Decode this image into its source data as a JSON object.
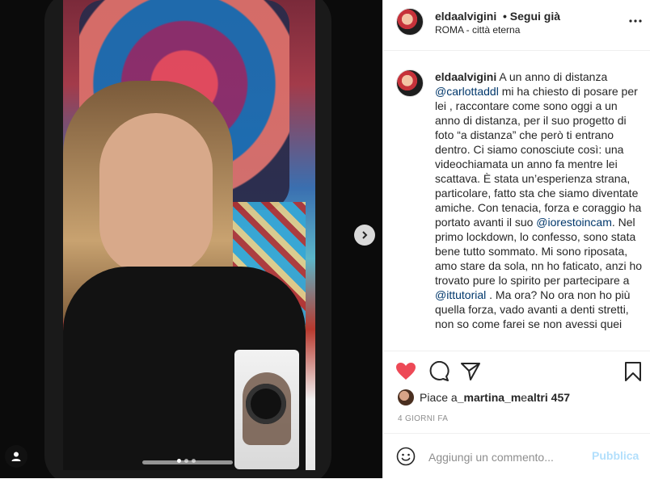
{
  "post": {
    "username": "eldaalvigini",
    "follow_status": "• Segui già",
    "location": "ROMA - città eterna",
    "more_icon": "more-horizontal-icon"
  },
  "caption": {
    "username": "eldaalvigini",
    "part1": " A un anno di distanza ",
    "mention1": "@carlottaddl",
    "part2": " mi ha chiesto di posare per lei , raccontare come sono oggi a un anno di distanza, per il suo progetto di foto “a distanza” che però ti entrano dentro. Ci siamo conosciute così: una videochiamata un anno fa mentre lei scattava. È stata un’esperienza strana, particolare, fatto sta che siamo diventate amiche. Con tenacia, forza e coraggio ha portato avanti il suo ",
    "mention2": "@iorestoincam",
    "part3": ". Nel primo lockdown, lo confesso, sono stata bene tutto sommato. Mi sono riposata, amo stare da sola, nn ho faticato, anzi ho trovato pure lo spirito per partecipare a ",
    "mention3": "@ittutorial",
    "part4": " . Ma ora? No ora non ho più quella forza, vado avanti a denti stretti, non so come farei se non avessi quei"
  },
  "likes": {
    "prefix": "Piace a ",
    "user": "_martina_m",
    "middle": " e ",
    "others": "altri 457"
  },
  "timestamp": "4 GIORNI FA",
  "comment": {
    "placeholder": "Aggiungi un commento...",
    "publish_label": "Pubblica"
  },
  "colors": {
    "heart": "#ed4956",
    "mention": "#00376b",
    "publish_disabled": "#b2dffc"
  }
}
